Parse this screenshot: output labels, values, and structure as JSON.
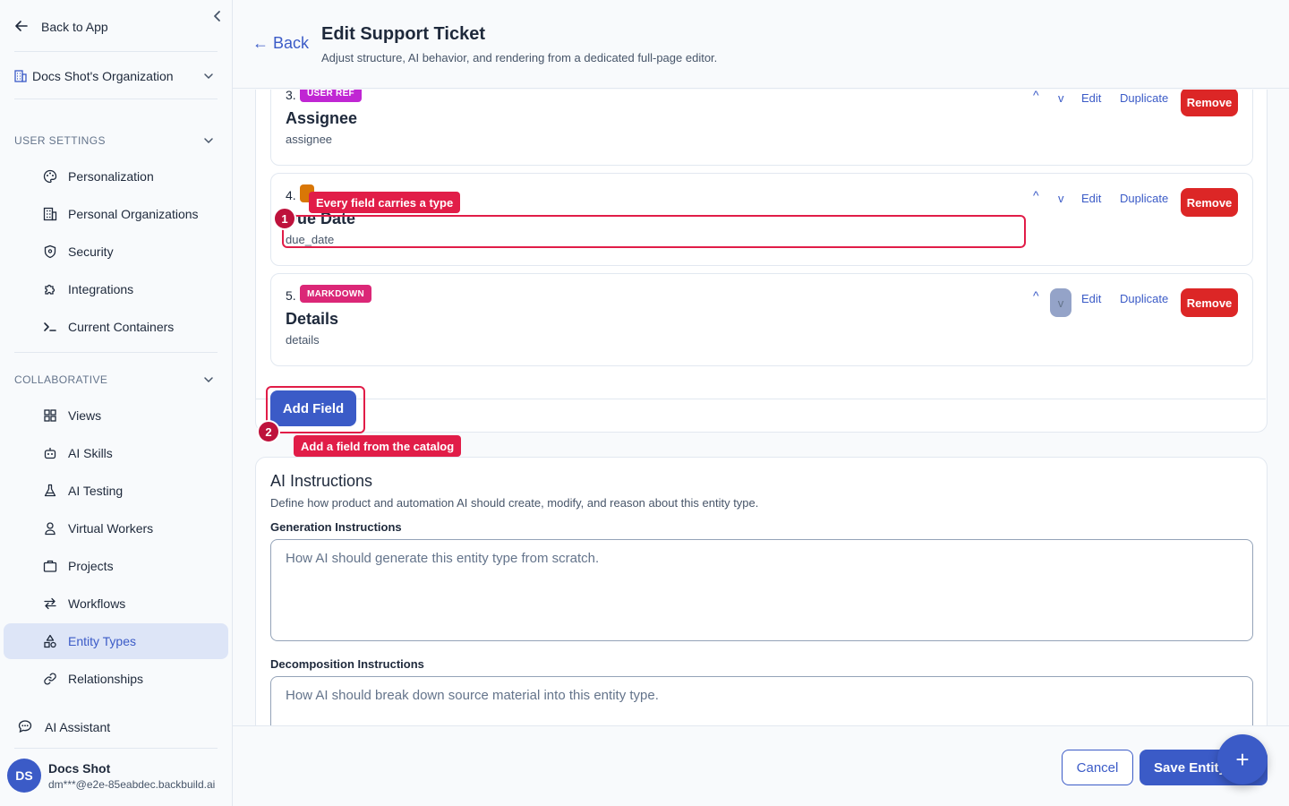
{
  "sidebar": {
    "back_label": "Back to App",
    "org_name": "Docs Shot's Organization",
    "user_settings_heading": "USER SETTINGS",
    "user_settings_items": [
      {
        "label": "Personalization",
        "icon": "palette-icon"
      },
      {
        "label": "Personal Organizations",
        "icon": "building-icon"
      },
      {
        "label": "Security",
        "icon": "shield-icon"
      },
      {
        "label": "Integrations",
        "icon": "puzzle-icon"
      },
      {
        "label": "Current Containers",
        "icon": "terminal-icon"
      }
    ],
    "collaborative_heading": "COLLABORATIVE",
    "collaborative_items": [
      {
        "label": "Views",
        "icon": "grid-icon"
      },
      {
        "label": "AI Skills",
        "icon": "robot-icon"
      },
      {
        "label": "AI Testing",
        "icon": "flask-icon"
      },
      {
        "label": "Virtual Workers",
        "icon": "worker-icon"
      },
      {
        "label": "Projects",
        "icon": "briefcase-icon"
      },
      {
        "label": "Workflows",
        "icon": "arrows-icon"
      },
      {
        "label": "Entity Types",
        "icon": "shapes-icon",
        "active": true
      },
      {
        "label": "Relationships",
        "icon": "link-icon"
      }
    ],
    "assistant_label": "AI Assistant",
    "user": {
      "initials": "DS",
      "name": "Docs Shot",
      "email": "dm***@e2e-85eabdec.backbuild.ai"
    }
  },
  "header": {
    "back_label": "← Back",
    "title": "Edit Support Ticket",
    "subtitle": "Adjust structure, AI behavior, and rendering from a dedicated full-page editor."
  },
  "fields": [
    {
      "number": "3.",
      "type": "USER REF",
      "type_color": "#c026d3",
      "label": "Assignee",
      "key": "assignee"
    },
    {
      "number": "4.",
      "type": "",
      "type_color": "#d97706",
      "label": "Due Date",
      "key": "due_date"
    },
    {
      "number": "5.",
      "type": "MARKDOWN",
      "type_color": "#db2777",
      "label": "Details",
      "key": "details"
    }
  ],
  "field_actions": {
    "up": "^",
    "down": "v",
    "edit": "Edit",
    "duplicate": "Duplicate",
    "remove": "Remove"
  },
  "add_field_label": "Add Field",
  "annotations": {
    "tip1_number": "1",
    "tip1_text": "Every field carries a type",
    "tip2_number": "2",
    "tip2_text": "Add a field from the catalog",
    "color": "#e11d48"
  },
  "ai_section": {
    "title": "AI Instructions",
    "description": "Define how product and automation AI should create, modify, and reason about this entity type.",
    "generation_label": "Generation Instructions",
    "generation_placeholder": "How AI should generate this entity type from scratch.",
    "decomposition_label": "Decomposition Instructions",
    "decomposition_placeholder": "How AI should break down source material into this entity type."
  },
  "footer": {
    "cancel_label": "Cancel",
    "save_label": "Save Entity",
    "fab_label": "+"
  },
  "colors": {
    "accent": "#3b5bc7",
    "danger": "#dc2626"
  }
}
